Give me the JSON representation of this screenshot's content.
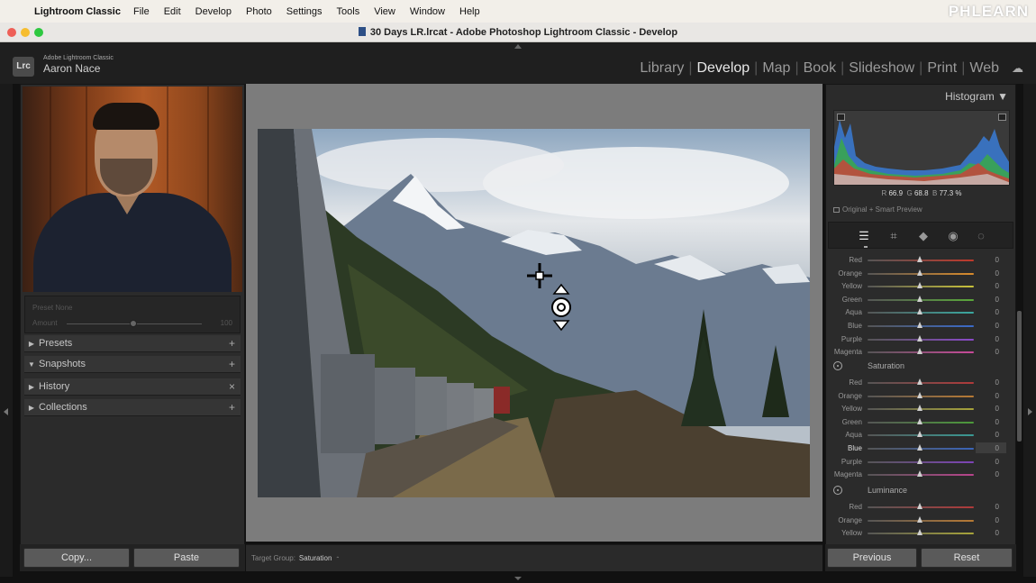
{
  "menubar": {
    "app": "Lightroom Classic",
    "items": [
      "File",
      "Edit",
      "Develop",
      "Photo",
      "Settings",
      "Tools",
      "View",
      "Window",
      "Help"
    ],
    "brand": "PHLEARN"
  },
  "window": {
    "title": "30 Days LR.lrcat - Adobe Photoshop Lightroom Classic - Develop"
  },
  "identity": {
    "small": "Adobe Lightroom Classic",
    "name": "Aaron Nace",
    "logo": "Lrc"
  },
  "modules": [
    "Library",
    "Develop",
    "Map",
    "Book",
    "Slideshow",
    "Print",
    "Web"
  ],
  "navigator": {
    "preset_label": "Preset   None",
    "amount_label": "Amount",
    "amount_value": "100",
    "amount_level": 0.5
  },
  "left_sections": [
    {
      "label": "Presets",
      "tri": "▶",
      "action": "+"
    },
    {
      "label": "Snapshots",
      "tri": "▼",
      "action": "+"
    },
    {
      "label": "History",
      "tri": "▶",
      "action": "×"
    },
    {
      "label": "Collections",
      "tri": "▶",
      "action": "+"
    }
  ],
  "left_buttons": {
    "copy": "Copy...",
    "paste": "Paste"
  },
  "toolbar": {
    "label": "Target Group:",
    "value": "Saturation",
    "dropdown": "⌃"
  },
  "histogram": {
    "title": "Histogram",
    "r_label": "R",
    "r": "66.9",
    "g_label": "G",
    "g": "68.8",
    "b_label": "B",
    "b": "77.3",
    "unit": "%",
    "preview": "Original + Smart Preview"
  },
  "hsl": {
    "hue_rows": [
      {
        "name": "Red",
        "value": "0",
        "color": "#c0392b"
      },
      {
        "name": "Orange",
        "value": "0",
        "color": "#d98b2b"
      },
      {
        "name": "Yellow",
        "value": "0",
        "color": "#c9c23a"
      },
      {
        "name": "Green",
        "value": "0",
        "color": "#5aa83a"
      },
      {
        "name": "Aqua",
        "value": "0",
        "color": "#3aa8a0"
      },
      {
        "name": "Blue",
        "value": "0",
        "color": "#3a6ac9"
      },
      {
        "name": "Purple",
        "value": "0",
        "color": "#8a4ac9"
      },
      {
        "name": "Magenta",
        "value": "0",
        "color": "#c94a9a"
      }
    ],
    "saturation_label": "Saturation",
    "saturation_rows": [
      {
        "name": "Red",
        "value": "0",
        "color": "#b03a3a"
      },
      {
        "name": "Orange",
        "value": "0",
        "color": "#b87a34"
      },
      {
        "name": "Yellow",
        "value": "0",
        "color": "#a8a43a"
      },
      {
        "name": "Green",
        "value": "0",
        "color": "#4c9a3a"
      },
      {
        "name": "Aqua",
        "value": "0",
        "color": "#3a9a94"
      },
      {
        "name": "Blue",
        "value": "0",
        "color": "#3a64b8"
      },
      {
        "name": "Purple",
        "value": "0",
        "color": "#7e44b8"
      },
      {
        "name": "Magenta",
        "value": "0",
        "color": "#b8448c"
      }
    ],
    "luminance_label": "Luminance",
    "luminance_rows": [
      {
        "name": "Red",
        "value": "0",
        "color": "#b03a3a"
      },
      {
        "name": "Orange",
        "value": "0",
        "color": "#b87a34"
      },
      {
        "name": "Yellow",
        "value": "0",
        "color": "#a8a43a"
      }
    ]
  },
  "right_buttons": {
    "previous": "Previous",
    "reset": "Reset"
  }
}
